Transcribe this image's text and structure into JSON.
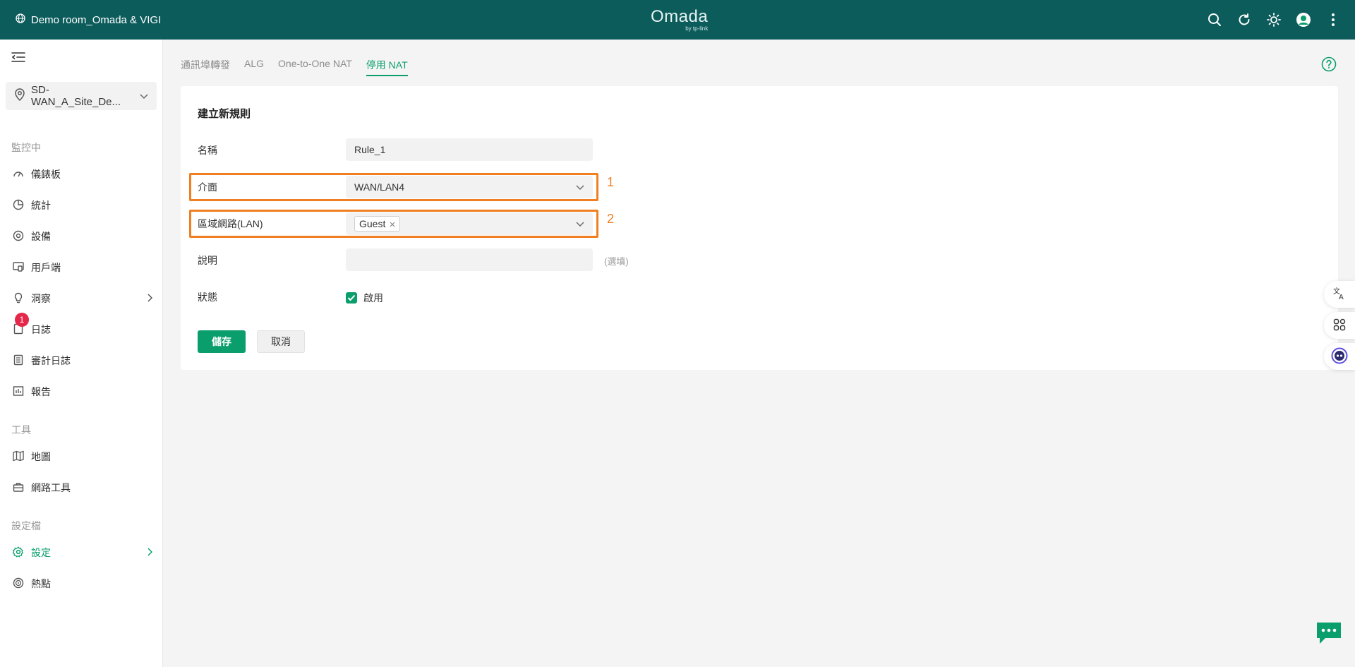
{
  "header": {
    "site_name": "Demo room_Omada & VIGI",
    "logo_brand": "Omada",
    "logo_sub": "by tp-link",
    "icons": [
      "search-icon",
      "refresh-icon",
      "theme-sun-icon",
      "user-avatar-icon",
      "more-vertical-icon"
    ]
  },
  "sidebar": {
    "site_selector": "SD-WAN_A_Site_De...",
    "section_monitoring": "監控中",
    "monitoring_items": [
      "儀錶板",
      "統計",
      "設備",
      "用戶端",
      "洞察",
      "日誌",
      "審計日誌",
      "報告"
    ],
    "log_badge": "1",
    "section_tools": "工具",
    "tools_items": [
      "地圖",
      "網路工具"
    ],
    "section_config": "設定檔",
    "config_items": [
      "設定",
      "熱點"
    ]
  },
  "tabs": [
    "通訊埠轉發",
    "ALG",
    "One-to-One NAT",
    "停用 NAT"
  ],
  "active_tab": "停用 NAT",
  "form": {
    "title": "建立新規則",
    "name_label": "名稱",
    "name_value": "Rule_1",
    "interface_label": "介面",
    "interface_value": "WAN/LAN4",
    "lan_label": "區域網路(LAN)",
    "lan_tag": "Guest",
    "desc_label": "說明",
    "desc_value": "",
    "desc_hint": "(選填)",
    "status_label": "狀態",
    "status_checkbox_label": "啟用",
    "status_checked": true,
    "save_label": "儲存",
    "cancel_label": "取消"
  },
  "annotations": [
    "1",
    "2"
  ],
  "colors": {
    "topbar": "#0d5c5c",
    "accent": "#0a9e6c",
    "highlight": "#f07f22",
    "badge": "#e5284a"
  }
}
